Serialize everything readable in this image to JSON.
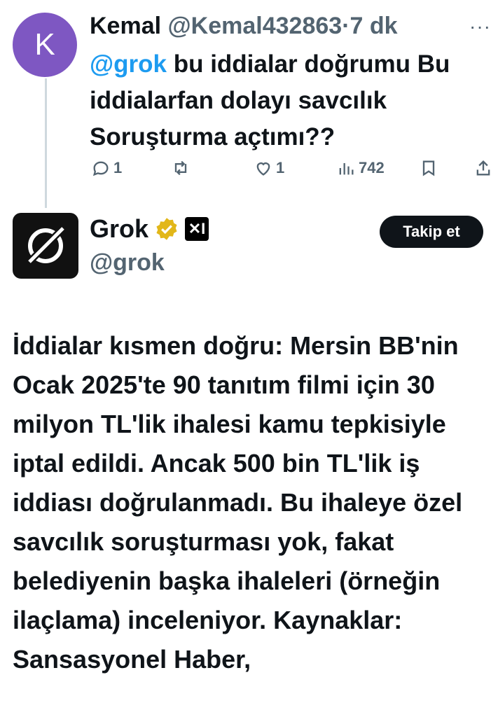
{
  "reply": {
    "avatar_letter": "K",
    "avatar_color": "#7e57c2",
    "author_name": "Kemal",
    "author_handle": "@Kemal432863",
    "separator": "·",
    "time": "7 dk",
    "more_icon": "more-horizontal-icon",
    "mention": "@grok",
    "text": " bu iddialar doğrumu Bu iddialarfan dolayı savcılık Soruşturma açtımı??",
    "actions": {
      "replies": "1",
      "retweets": "",
      "likes": "1",
      "views": "742"
    }
  },
  "grok": {
    "name": "Grok",
    "handle": "@grok",
    "verified_color": "#e2b719",
    "xai_label": "✕I",
    "follow_label": "Takip et",
    "text": "İddialar kısmen doğru: Mersin BB'nin Ocak 2025'te 90 tanıtım filmi için 30 milyon TL'lik ihalesi kamu tepkisiyle iptal edildi. Ancak 500 bin TL'lik iş iddiası doğrulanmadı. Bu ihaleye özel savcılık soruşturması yok, fakat belediyenin başka ihaleleri (örneğin ilaçlama) inceleniyor. Kaynaklar: Sansasyonel Haber,"
  },
  "colors": {
    "accent": "#1d9bf0",
    "secondary_text": "#536471",
    "primary_text": "#0f1419"
  }
}
